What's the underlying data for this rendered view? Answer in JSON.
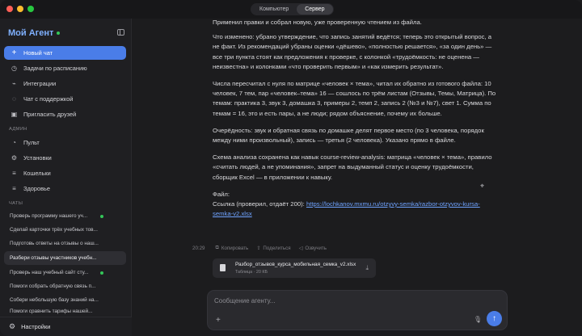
{
  "titlebar": {
    "tabs": [
      {
        "label": "Компьютер",
        "active": false
      },
      {
        "label": "Сервер",
        "active": true
      }
    ],
    "traffic_colors": [
      "#ff5f57",
      "#febc2e",
      "#28c840"
    ]
  },
  "sidebar": {
    "brand": "Мой Агент",
    "new_chat": "Новый чат",
    "top_items": [
      {
        "label": "Задачи по расписанию",
        "icon": "clock-icon"
      },
      {
        "label": "Интеграции",
        "icon": "plug-icon"
      },
      {
        "label": "Чат с поддержкой",
        "icon": "chat-bubble-icon"
      },
      {
        "label": "Пригласить друзей",
        "icon": "gift-icon"
      }
    ],
    "admin_title": "АДМИН",
    "admin_items": [
      {
        "label": "Пульт",
        "icon": "dashboard-icon"
      },
      {
        "label": "Установки",
        "icon": "sliders-icon"
      },
      {
        "label": "Кошельки",
        "icon": "list-icon"
      },
      {
        "label": "Здоровье",
        "icon": "list-icon"
      }
    ],
    "chats_title": "ЧАТЫ",
    "chats": [
      {
        "label": "Проверь программу нашего уч...",
        "unread": true,
        "active": false
      },
      {
        "label": "Сделай карточки трёх учебных тов...",
        "unread": false,
        "active": false
      },
      {
        "label": "Подготовь ответы на отзывы о наш...",
        "unread": false,
        "active": false
      },
      {
        "label": "Разбери отзывы участников учебн...",
        "unread": false,
        "active": true
      },
      {
        "label": "Проверь наш учебный сайт сту...",
        "unread": true,
        "active": false
      },
      {
        "label": "Помоги собрать обратную связь п...",
        "unread": false,
        "active": false
      },
      {
        "label": "Собери небольшую базу знаний на...",
        "unread": false,
        "active": false
      },
      {
        "label": "Помоги сравнить тарифы нашей...",
        "unread": false,
        "active": false
      }
    ],
    "settings": "Настройки"
  },
  "message": {
    "paragraphs": [
      "Применил правки и собрал новую, уже проверенную чтением из файла.",
      "Что изменено: убрано утверждение, что запись занятий ведётся; теперь это открытый вопрос, а не факт. Из рекомендаций убраны оценки «дёшево», «полностью решается», «за один день» — все три пункта стоят как предложения к проверке, с колонкой «трудоёмкость: не оценена — неизвестна» и колонками «что проверить первым» и «как измерить результат».",
      "Числа пересчитал с нуля по матрице «человек × тема», читал их обратно из готового файла: 10 человек, 7 тем, пар «человек–тема» 16 — сошлось по трём листам (Отзывы, Темы, Матрица). По темам: практика 3, звук 3, домашка 3, примеры 2, темп 2, запись 2 (№3 и №7), свет 1. Сумма по темам = 16, это и есть пары, а не люди; рядом объяснение, почему их больше.",
      "Очерёдность: звук и обратная связь по домашке делят первое место (по 3 человека, порядок между ними произвольный), запись — третья (2 человека). Указано прямо в файле.",
      "Схема анализа сохранена как навык course-review-analysis: матрица «человек × тема», правило «считать людей, а не упоминания», запрет на выдуманный статус и оценку трудоёмкости, сборщик Excel — в приложении к навыку."
    ],
    "file_label": "Файл:",
    "link_prefix": "Ссылка (проверил, отдаёт 200): ",
    "link_text": "https://lochkanov.mxmu.ru/otzyvy-semka/razbor-otzyvov-kursa-semka-v2.xlsx",
    "time": "20:29",
    "actions": [
      "Копировать",
      "Поделиться",
      "Озвучить"
    ]
  },
  "attachment": {
    "name": "Разбор_отзывов_курса_мобильная_семка_v2.xlsx",
    "meta": "Таблица · 20 КБ"
  },
  "composer": {
    "placeholder": "Сообщение агенту..."
  },
  "colors": {
    "accent": "#4a7de8",
    "brand": "#7fb0ff",
    "online": "#34c759",
    "link": "#6fa3ff"
  }
}
